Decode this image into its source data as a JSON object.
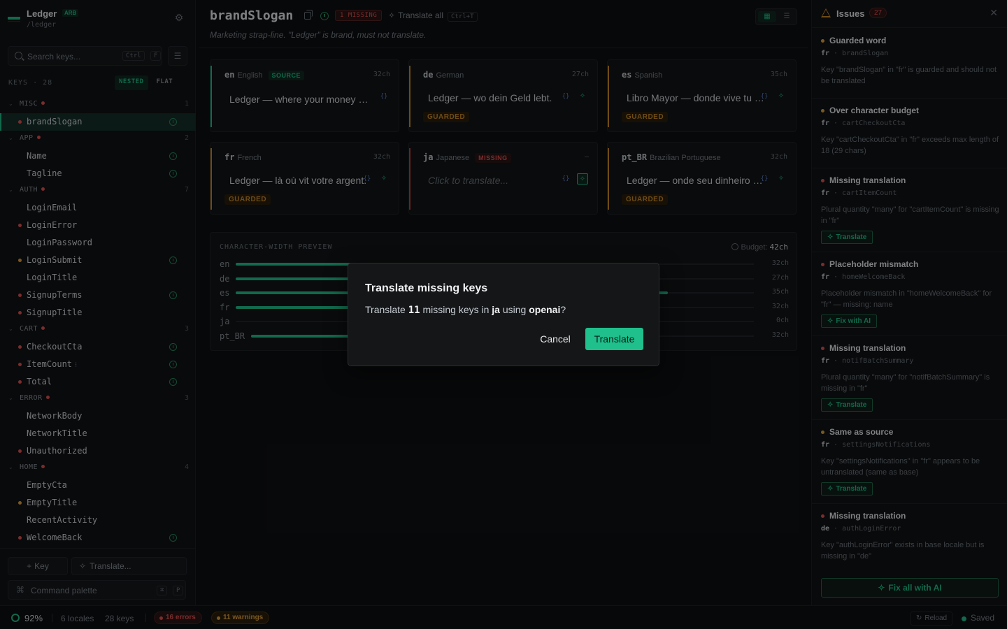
{
  "app": {
    "name": "Ledger",
    "badge": "ARB",
    "path": "/ledger"
  },
  "sidebar": {
    "search_placeholder": "Search keys...",
    "search_kbd1": "Ctrl",
    "search_kbd2": "F",
    "keys_label": "KEYS · 28",
    "view_nested": "NESTED",
    "view_flat": "FLAT",
    "groups": [
      {
        "name": "MISC",
        "count": "1",
        "items": [
          {
            "name": "brandSlogan",
            "dot": "err",
            "icon": true,
            "selected": true
          }
        ]
      },
      {
        "name": "APP",
        "count": "2",
        "items": [
          {
            "name": "Name",
            "dot": "",
            "icon": true
          },
          {
            "name": "Tagline",
            "dot": "",
            "icon": true
          }
        ]
      },
      {
        "name": "AUTH",
        "count": "7",
        "items": [
          {
            "name": "LoginEmail",
            "dot": ""
          },
          {
            "name": "LoginError",
            "dot": "err"
          },
          {
            "name": "LoginPassword",
            "dot": ""
          },
          {
            "name": "LoginSubmit",
            "dot": "warn",
            "icon": true
          },
          {
            "name": "LoginTitle",
            "dot": ""
          },
          {
            "name": "SignupTerms",
            "dot": "err",
            "icon": true
          },
          {
            "name": "SignupTitle",
            "dot": "err"
          }
        ]
      },
      {
        "name": "CART",
        "count": "3",
        "items": [
          {
            "name": "CheckoutCta",
            "dot": "err",
            "icon": true
          },
          {
            "name": "ItemCount",
            "dot": "err",
            "icon": true,
            "plural": true
          },
          {
            "name": "Total",
            "dot": "err",
            "icon": true
          }
        ]
      },
      {
        "name": "ERROR",
        "count": "3",
        "items": [
          {
            "name": "NetworkBody",
            "dot": ""
          },
          {
            "name": "NetworkTitle",
            "dot": ""
          },
          {
            "name": "Unauthorized",
            "dot": "err"
          }
        ]
      },
      {
        "name": "HOME",
        "count": "4",
        "items": [
          {
            "name": "EmptyCta",
            "dot": ""
          },
          {
            "name": "EmptyTitle",
            "dot": "warn"
          },
          {
            "name": "RecentActivity",
            "dot": ""
          },
          {
            "name": "WelcomeBack",
            "dot": "err",
            "icon": true
          }
        ]
      }
    ],
    "add_key_label": "Key",
    "translate_label": "Translate...",
    "command_palette_label": "Command palette",
    "cmd_kbd1": "⌘",
    "cmd_kbd2": "P"
  },
  "main": {
    "key_title": "brandSlogan",
    "missing_badge": "1 MISSING",
    "translate_all_label": "Translate all",
    "translate_all_kbd": "Ctrl+T",
    "description": "Marketing strap-line. \"Ledger\" is brand, must not translate.",
    "cards": [
      {
        "code": "en",
        "name": "English",
        "tag": "SOURCE",
        "tag_kind": "src",
        "chars": "32ch",
        "text": "Ledger — where your money lives.",
        "guarded": "",
        "bar": "green",
        "placeholder": false
      },
      {
        "code": "de",
        "name": "German",
        "tag": "",
        "tag_kind": "",
        "chars": "27ch",
        "text": "Ledger — wo dein Geld lebt.",
        "guarded": "GUARDED",
        "bar": "amber",
        "placeholder": false
      },
      {
        "code": "es",
        "name": "Spanish",
        "tag": "",
        "tag_kind": "",
        "chars": "35ch",
        "text": "Libro Mayor — donde vive tu dinero.",
        "guarded": "GUARDED",
        "bar": "amber",
        "placeholder": false
      },
      {
        "code": "fr",
        "name": "French",
        "tag": "",
        "tag_kind": "",
        "chars": "32ch",
        "text": "Ledger — là où vit votre argent.",
        "guarded": "GUARDED",
        "bar": "amber",
        "placeholder": false
      },
      {
        "code": "ja",
        "name": "Japanese",
        "tag": "MISSING",
        "tag_kind": "miss",
        "chars": "–",
        "text": "Click to translate...",
        "guarded": "",
        "bar": "red",
        "placeholder": true
      },
      {
        "code": "pt_BR",
        "name": "Brazilian Portuguese",
        "tag": "",
        "tag_kind": "",
        "chars": "32ch",
        "text": "Ledger — onde seu dinheiro vive.",
        "guarded": "GUARDED",
        "bar": "amber",
        "placeholder": false
      }
    ],
    "preview": {
      "title": "CHARACTER-WIDTH PREVIEW",
      "budget_label": "Budget:",
      "budget_value": "42ch",
      "budget": 42,
      "rows": [
        {
          "locale": "en",
          "chars": 32,
          "label": "32ch"
        },
        {
          "locale": "de",
          "chars": 27,
          "label": "27ch"
        },
        {
          "locale": "es",
          "chars": 35,
          "label": "35ch"
        },
        {
          "locale": "fr",
          "chars": 32,
          "label": "32ch"
        },
        {
          "locale": "ja",
          "chars": 0,
          "label": "0ch"
        },
        {
          "locale": "pt_BR",
          "chars": 32,
          "label": "32ch"
        }
      ]
    }
  },
  "issues": {
    "title": "Issues",
    "count": "27",
    "list": [
      {
        "kind": "warn",
        "title": "Guarded word",
        "locale": "fr",
        "key": "brandSlogan",
        "desc": "Key \"brandSlogan\" in \"fr\" is guarded and should not be translated",
        "action": ""
      },
      {
        "kind": "warn",
        "title": "Over character budget",
        "locale": "fr",
        "key": "cartCheckoutCta",
        "desc": "Key \"cartCheckoutCta\" in \"fr\" exceeds max length of 18 (29 chars)",
        "action": ""
      },
      {
        "kind": "err",
        "title": "Missing translation",
        "locale": "fr",
        "key": "cartItemCount",
        "desc": "Plural quantity \"many\" for \"cartItemCount\" is missing in \"fr\"",
        "action": "Translate"
      },
      {
        "kind": "err",
        "title": "Placeholder mismatch",
        "locale": "fr",
        "key": "homeWelcomeBack",
        "desc": "Placeholder mismatch in \"homeWelcomeBack\" for \"fr\" — missing: name",
        "action": "Fix with AI"
      },
      {
        "kind": "err",
        "title": "Missing translation",
        "locale": "fr",
        "key": "notifBatchSummary",
        "desc": "Plural quantity \"many\" for \"notifBatchSummary\" is missing in \"fr\"",
        "action": "Translate"
      },
      {
        "kind": "warn",
        "title": "Same as source",
        "locale": "fr",
        "key": "settingsNotifications",
        "desc": "Key \"settingsNotifications\" in \"fr\" appears to be untranslated (same as base)",
        "action": "Translate"
      },
      {
        "kind": "err",
        "title": "Missing translation",
        "locale": "de",
        "key": "authLoginError",
        "desc": "Key \"authLoginError\" exists in base locale but is missing in \"de\"",
        "action": ""
      }
    ],
    "fix_all_label": "Fix all with AI"
  },
  "status": {
    "percent": "92%",
    "locales": "6 locales",
    "keys": "28 keys",
    "errors": "16 errors",
    "warnings": "11 warnings",
    "reload": "Reload",
    "saved": "Saved"
  },
  "modal": {
    "title": "Translate missing keys",
    "body_pre": "Translate ",
    "count": "11",
    "body_mid": " missing keys in ",
    "locale": "ja",
    "body_mid2": " using ",
    "provider": "openai",
    "body_post": "?",
    "cancel": "Cancel",
    "confirm": "Translate"
  },
  "colors": {
    "accent": "#22c08a",
    "error": "#e05252",
    "warning": "#e0a040"
  }
}
